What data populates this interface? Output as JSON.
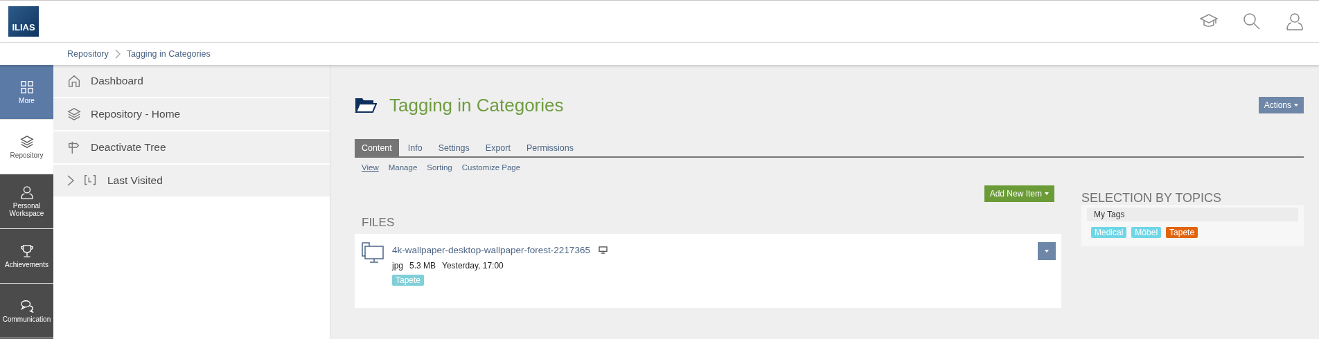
{
  "header": {
    "logo": "ILIAS"
  },
  "breadcrumbs": [
    "Repository",
    "Tagging in Categories"
  ],
  "slate": [
    {
      "label": "More",
      "engaged": true,
      "selected": false
    },
    {
      "label": "Repository",
      "engaged": false,
      "selected": true
    },
    {
      "label": "Personal Workspace",
      "engaged": false,
      "selected": false
    },
    {
      "label": "Achievements",
      "engaged": false,
      "selected": false
    },
    {
      "label": "Communication",
      "engaged": false,
      "selected": false
    }
  ],
  "menu": [
    {
      "label": "Dashboard",
      "kind": "link"
    },
    {
      "label": "Repository - Home",
      "kind": "link"
    },
    {
      "label": "Deactivate Tree",
      "kind": "link"
    },
    {
      "label": "Last Visited",
      "kind": "expandable",
      "expanded": false
    }
  ],
  "page": {
    "title": "Tagging in Categories",
    "actions_button": "Actions",
    "tabs": [
      {
        "label": "Content",
        "selected": true
      },
      {
        "label": "Info",
        "selected": false
      },
      {
        "label": "Settings",
        "selected": false
      },
      {
        "label": "Export",
        "selected": false
      },
      {
        "label": "Permissions",
        "selected": false
      }
    ],
    "subtabs": [
      {
        "label": "View",
        "selected": true
      },
      {
        "label": "Manage",
        "selected": false
      },
      {
        "label": "Sorting",
        "selected": false
      },
      {
        "label": "Customize Page",
        "selected": false
      }
    ],
    "add_button": "Add New Item",
    "files": {
      "heading": "FILES",
      "items": [
        {
          "name": "4k-wallpaper-desktop-wallpaper-forest-2217365",
          "type": "jpg",
          "size": "5.3 MB",
          "date": "Yesterday, 17:00",
          "tags": [
            {
              "label": "Tapete",
              "color": "#7fcfd8"
            }
          ]
        }
      ]
    },
    "topics": {
      "heading": "SELECTION BY TOPICS",
      "group": "My Tags",
      "tags": [
        {
          "label": "Medical",
          "color": "#6fd6e6"
        },
        {
          "label": "Möbel",
          "color": "#6fd6e6"
        },
        {
          "label": "Tapete",
          "color": "#e2650e"
        }
      ]
    }
  }
}
